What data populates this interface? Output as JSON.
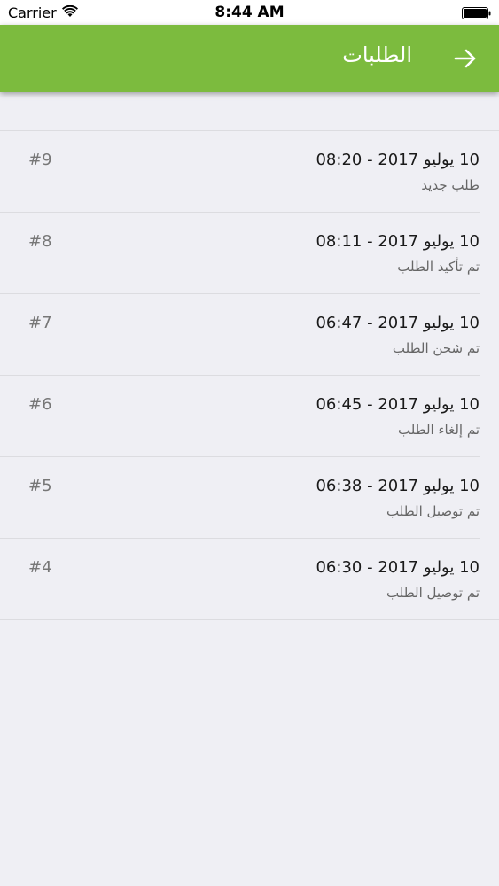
{
  "status_bar": {
    "carrier": "Carrier",
    "time": "8:44 AM"
  },
  "header": {
    "title": "الطلبات",
    "back_icon": "arrow-right-icon",
    "color": "#7cbb3e"
  },
  "orders": [
    {
      "number": "#9",
      "date": "10 يوليو 2017 - 08:20",
      "status": "طلب جديد"
    },
    {
      "number": "#8",
      "date": "10 يوليو 2017 - 08:11",
      "status": "تم تأكيد الطلب"
    },
    {
      "number": "#7",
      "date": "10 يوليو 2017 - 06:47",
      "status": "تم شحن الطلب"
    },
    {
      "number": "#6",
      "date": "10 يوليو 2017 - 06:45",
      "status": "تم إلغاء الطلب"
    },
    {
      "number": "#5",
      "date": "10 يوليو 2017 - 06:38",
      "status": "تم توصيل الطلب"
    },
    {
      "number": "#4",
      "date": "10 يوليو 2017 - 06:30",
      "status": "تم توصيل الطلب"
    }
  ]
}
